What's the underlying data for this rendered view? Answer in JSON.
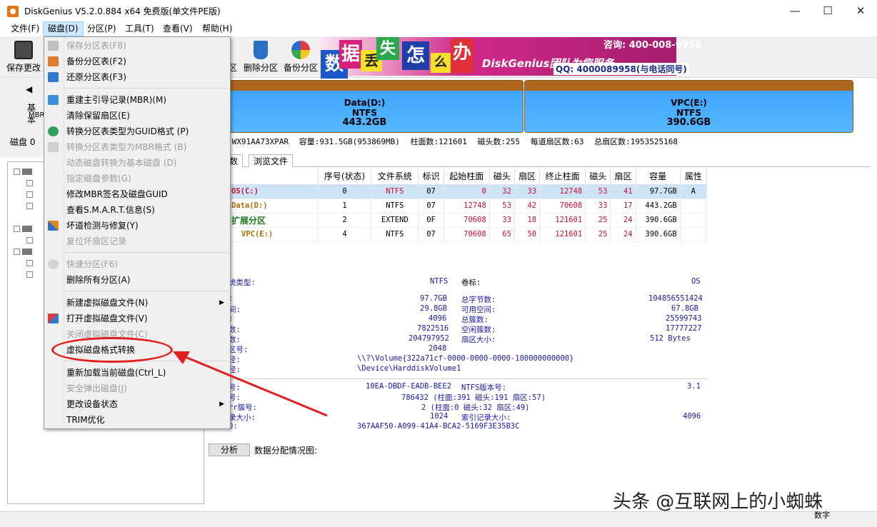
{
  "window": {
    "title": "DiskGenius V5.2.0.884 x64 免费版(单文件PE版)",
    "minimize": "—",
    "maximize": "☐",
    "close": "✕"
  },
  "menubar": [
    "文件(F)",
    "磁盘(D)",
    "分区(P)",
    "工具(T)",
    "查看(V)",
    "帮助(H)"
  ],
  "toolbar": {
    "save_label": "保存更改",
    "delete_partition_label": "删除分区",
    "backup_partition_label": "备份分区",
    "partial_label": "区"
  },
  "banner": {
    "chars": [
      "数",
      "据",
      "丢",
      "失",
      "怎",
      "么",
      "办"
    ],
    "slogan": "DiskGenius团队为您服务",
    "phone": "咨询: 400-008-9958",
    "qq": "QQ: 4000089958(与电话同号)"
  },
  "left_panel": {
    "basic": "基本",
    "mbr": "MBR",
    "disk_label": "磁盘 0"
  },
  "partitions_bar": [
    {
      "name": "Data(D:)",
      "fs": "NTFS",
      "size": "443.2GB"
    },
    {
      "name": "VPC(E:)",
      "fs": "NTFS",
      "size": "390.6GB"
    }
  ],
  "disk_info": {
    "model": "-WX91AA73XPAR",
    "capacity": "容量:931.5GB(953869MB)",
    "cylinders": "柱面数:121601",
    "heads": "磁头数:255",
    "sectors_per_track": "每道扇区数:63",
    "total_sectors": "总扇区数:1953525168"
  },
  "tabs": [
    "参数",
    "浏览文件"
  ],
  "table": {
    "headers": [
      "",
      "序号(状态)",
      "文件系统",
      "标识",
      "起始柱面",
      "磁头",
      "扇区",
      "终止柱面",
      "磁头",
      "扇区",
      "容量",
      "属性"
    ],
    "rows": [
      [
        "OS(C:)",
        "0",
        "NTFS",
        "07",
        "0",
        "32",
        "33",
        "12748",
        "53",
        "41",
        "97.7GB",
        "A"
      ],
      [
        "Data(D:)",
        "1",
        "NTFS",
        "07",
        "12748",
        "53",
        "42",
        "70608",
        "33",
        "17",
        "443.2GB",
        ""
      ],
      [
        "扩展分区",
        "2",
        "EXTEND",
        "0F",
        "70608",
        "33",
        "18",
        "121601",
        "25",
        "24",
        "390.6GB",
        ""
      ],
      [
        "VPC(E:)",
        "4",
        "NTFS",
        "07",
        "70608",
        "65",
        "50",
        "121601",
        "25",
        "24",
        "390.6GB",
        ""
      ]
    ]
  },
  "details": {
    "fs_type_label": "统类型:",
    "fs_type": "NTFS",
    "volume_label_label": "卷标:",
    "volume_label": "OS",
    "left_values": [
      "97.7GB",
      "29.8GB",
      "4096",
      "7822516",
      "204797952",
      "2048"
    ],
    "left_labels": [
      ":",
      "间:",
      ":",
      "数:",
      "数:",
      "区号:",
      "径:",
      "径:"
    ],
    "right_labels": [
      "总字节数:",
      "可用空间:",
      "总簇数:",
      "空闲簇数:",
      "扇区大小:"
    ],
    "right_values": [
      "104856551424",
      "67.8GB",
      "25599743",
      "17777227",
      "512 Bytes"
    ],
    "path1": "\\\\?\\Volume{322a71cf-0000-0000-0000-100000000000}",
    "path2": "\\Device\\HarddiskVolume1",
    "serial_label": "号:",
    "serial": "10EA-DBDF-EADB-BEE2",
    "ntfs_ver_label": "NTFS版本号:",
    "ntfs_ver": "3.1",
    "mft_label": "号:",
    "mft": "786432 (柱面:391 磁头:191 扇区:57)",
    "mftmirr_label": "rr簇号:",
    "mftmirr": "2 (柱面:0 磁头:32 扇区:49)",
    "record_size_label": "录大小:",
    "record_size": "1024",
    "index_size_label": "索引记录大小:",
    "index_size": "4096",
    "guid_label": "D:",
    "guid": "367AAF50-A099-41A4-BCA2-5169F3E35B3C"
  },
  "analyze": {
    "button": "分析",
    "label": "数据分配情况图:"
  },
  "status": {
    "num": "数字",
    "watermark": "头条 @互联网上的小蜘蛛"
  },
  "dropdown": [
    {
      "label": "保存分区表(F8)",
      "disabled": true
    },
    {
      "label": "备份分区表(F2)",
      "disabled": false
    },
    {
      "label": "还原分区表(F3)",
      "disabled": false
    },
    {
      "label": "重建主引导记录(MBR)(M)",
      "disabled": false
    },
    {
      "label": "清除保留扇区(E)",
      "disabled": false
    },
    {
      "label": "转换分区表类型为GUID格式 (P)",
      "disabled": false
    },
    {
      "label": "转换分区表类型为MBR格式 (B)",
      "disabled": true
    },
    {
      "label": "动态磁盘转换为基本磁盘 (D)",
      "disabled": true
    },
    {
      "label": "指定磁盘参数(G)",
      "disabled": true
    },
    {
      "label": "修改MBR签名及磁盘GUID",
      "disabled": false
    },
    {
      "label": "查看S.M.A.R.T.信息(S)",
      "disabled": false
    },
    {
      "label": "坏道检测与修复(Y)",
      "disabled": false
    },
    {
      "label": "复位坏扇区记录",
      "disabled": true
    },
    {
      "label": "快速分区(F6)",
      "disabled": true
    },
    {
      "label": "删除所有分区(A)",
      "disabled": false
    },
    {
      "label": "新建虚拟磁盘文件(N)",
      "disabled": false
    },
    {
      "label": "打开虚拟磁盘文件(V)",
      "disabled": false
    },
    {
      "label": "关闭虚拟磁盘文件(C)",
      "disabled": true
    },
    {
      "label": "虚拟磁盘格式转换",
      "disabled": false
    },
    {
      "label": "重新加载当前磁盘(Ctrl_L)",
      "disabled": false
    },
    {
      "label": "安全弹出磁盘(J)",
      "disabled": true
    },
    {
      "label": "更改设备状态",
      "disabled": false
    },
    {
      "label": "TRIM优化",
      "disabled": false
    }
  ],
  "colors": {
    "accent_highlight": "#cce8ff",
    "partition_fill": "#56b8ff",
    "partition_top": "#b0651e",
    "annotation_red": "#e02020",
    "table_blue": "#1a1aa8",
    "table_red": "#c8102e"
  }
}
